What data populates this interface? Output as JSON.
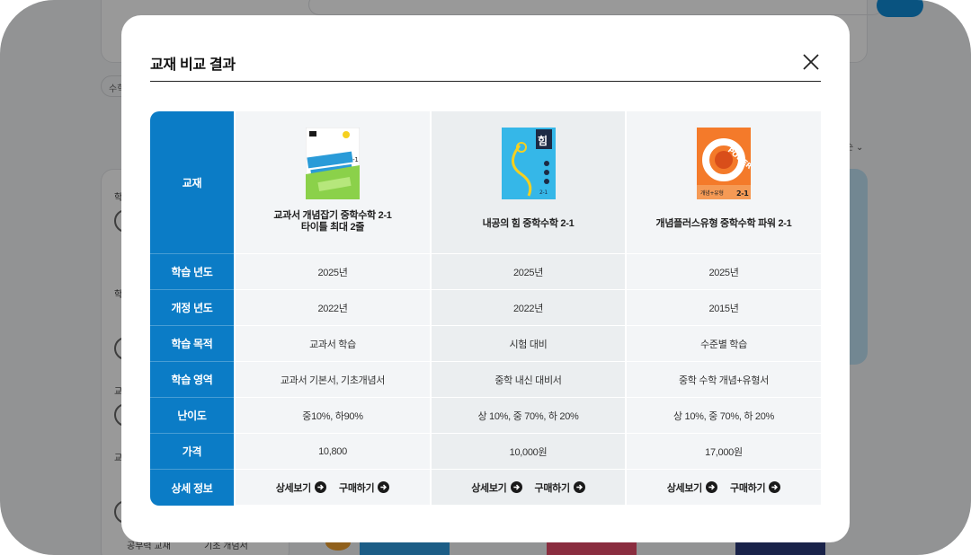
{
  "background": {
    "chip_label": "수학",
    "sort_label": "순 ⌄",
    "filter_labels": [
      "학",
      "학",
      "교",
      "교"
    ],
    "filter_footer": [
      "공부력 교재",
      "기초 개념서"
    ]
  },
  "modal": {
    "title": "교재 비교 결과",
    "close_icon": "close-icon",
    "row_headers": [
      "교재",
      "학습 년도",
      "개정 년도",
      "학습 목적",
      "학습 영역",
      "난이도",
      "가격",
      "상세 정보"
    ],
    "books": [
      {
        "name_line1": "교과서 개념잡기 중학수학 2-1",
        "name_line2": "타이틀 최대 2줄",
        "cover_colors": [
          "#ffffff",
          "#8bd14a",
          "#2a9bd8"
        ],
        "year": "2025년",
        "revision": "2022년",
        "purpose": "교과서 학습",
        "area": "교과서 기본서, 기초개념서",
        "difficulty": "중10%, 하90%",
        "price": "10,800",
        "detail_label": "상세보기",
        "buy_label": "구매하기"
      },
      {
        "name_line1": "내공의 힘 중학수학 2-1",
        "name_line2": "",
        "cover_colors": [
          "#35b7e8",
          "#f5d020",
          "#1c2a44"
        ],
        "year": "2025년",
        "revision": "2022년",
        "purpose": "시험 대비",
        "area": "중학 내신 대비서",
        "difficulty": "상 10%, 중 70%, 하 20%",
        "price": "10,000원",
        "detail_label": "상세보기",
        "buy_label": "구매하기"
      },
      {
        "name_line1": "개념플러스유형 중학수학 파워 2-1",
        "name_line2": "",
        "cover_colors": [
          "#f47a2a",
          "#ffffff",
          "#d94e1a"
        ],
        "year": "2025년",
        "revision": "2015년",
        "purpose": "수준별 학습",
        "area": "중학 수학 개념+유형서",
        "difficulty": "상 10%, 중 70%, 하 20%",
        "price": "17,000원",
        "detail_label": "상세보기",
        "buy_label": "구매하기"
      }
    ]
  }
}
